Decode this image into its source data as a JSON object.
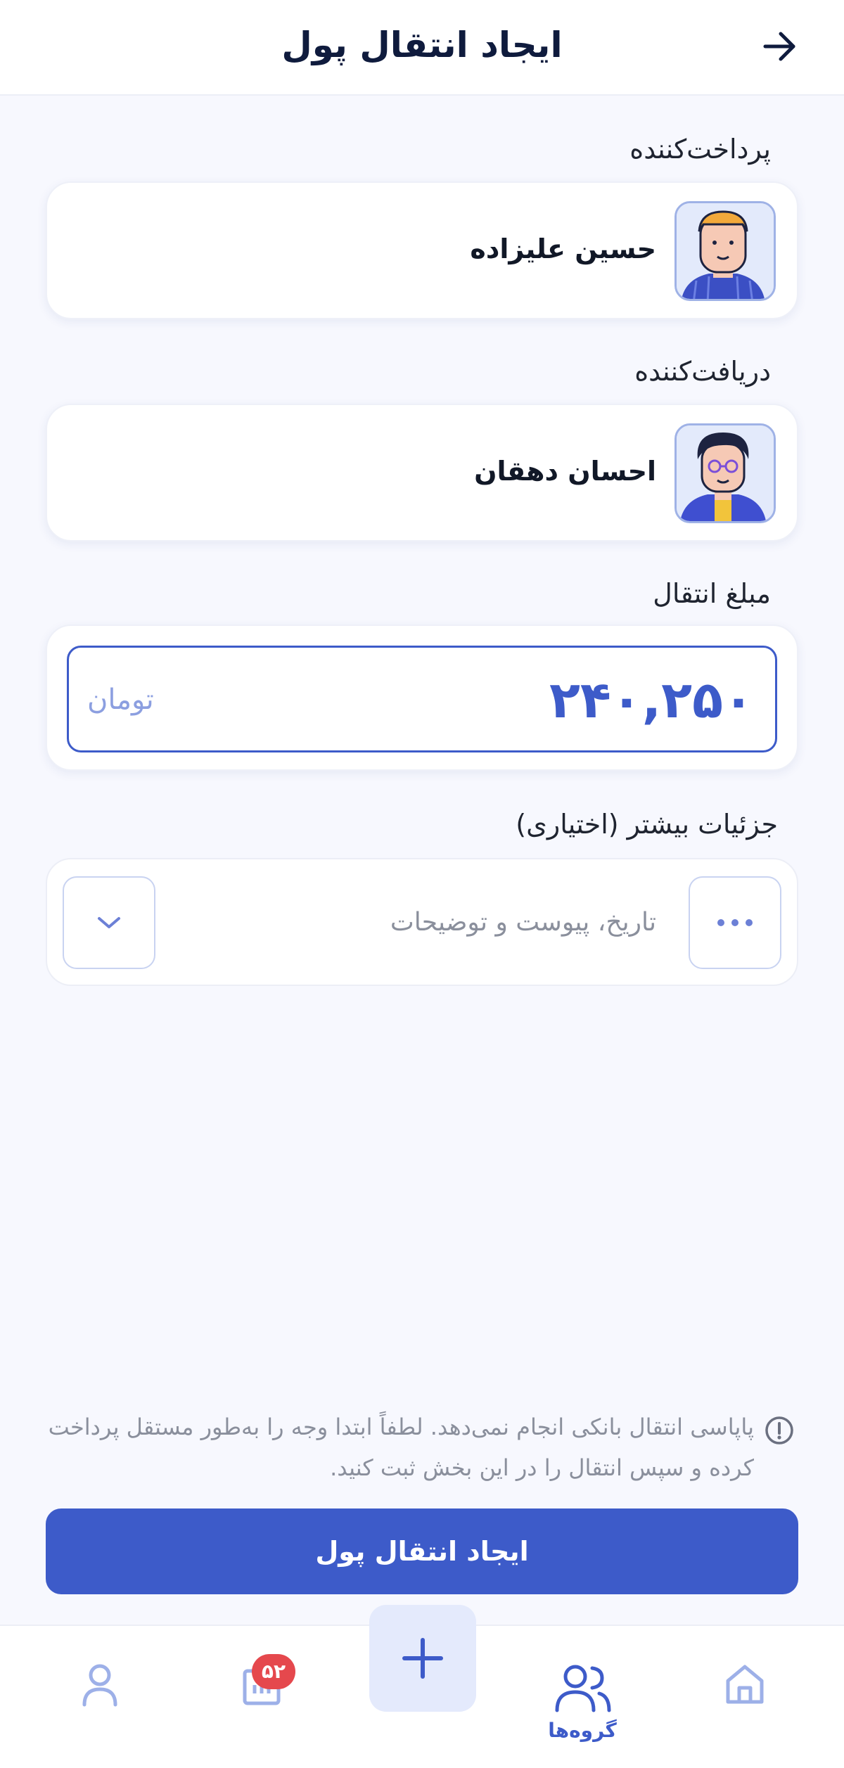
{
  "header": {
    "title": "ایجاد انتقال پول",
    "back_icon": "arrow-right-icon"
  },
  "payer": {
    "label": "پرداخت‌کننده",
    "name": "حسین علیزاده",
    "avatar_icon": "avatar-payer-icon"
  },
  "receiver": {
    "label": "دریافت‌کننده",
    "name": "احسان دهقان",
    "avatar_icon": "avatar-receiver-icon"
  },
  "amount": {
    "label": "مبلغ انتقال",
    "value": "۲۴۰,۲۵۰",
    "currency": "تومان"
  },
  "details": {
    "label": "جزئیات بیشتر (اختیاری)",
    "placeholder": "تاریخ، پیوست و توضیحات",
    "more_icon": "more-dots-icon",
    "expand_icon": "chevron-down-icon"
  },
  "notice": {
    "icon": "info-icon",
    "text": "پاپاسی انتقال بانکی انجام نمی‌دهد. لطفاً ابتدا وجه را به‌طور مستقل پرداخت کرده و سپس انتقال را در این بخش ثبت کنید."
  },
  "submit": {
    "label": "ایجاد انتقال پول"
  },
  "bottom_nav": {
    "home_icon": "home-icon",
    "groups_label": "گروه‌ها",
    "groups_icon": "users-icon",
    "add_icon": "plus-icon",
    "activity_icon": "chart-icon",
    "activity_badge": "۵۲",
    "profile_icon": "user-icon"
  },
  "colors": {
    "accent": "#3D5BC9",
    "accent_light": "#E4EAFC",
    "badge": "#E5484D",
    "background": "#F7F8FE"
  }
}
